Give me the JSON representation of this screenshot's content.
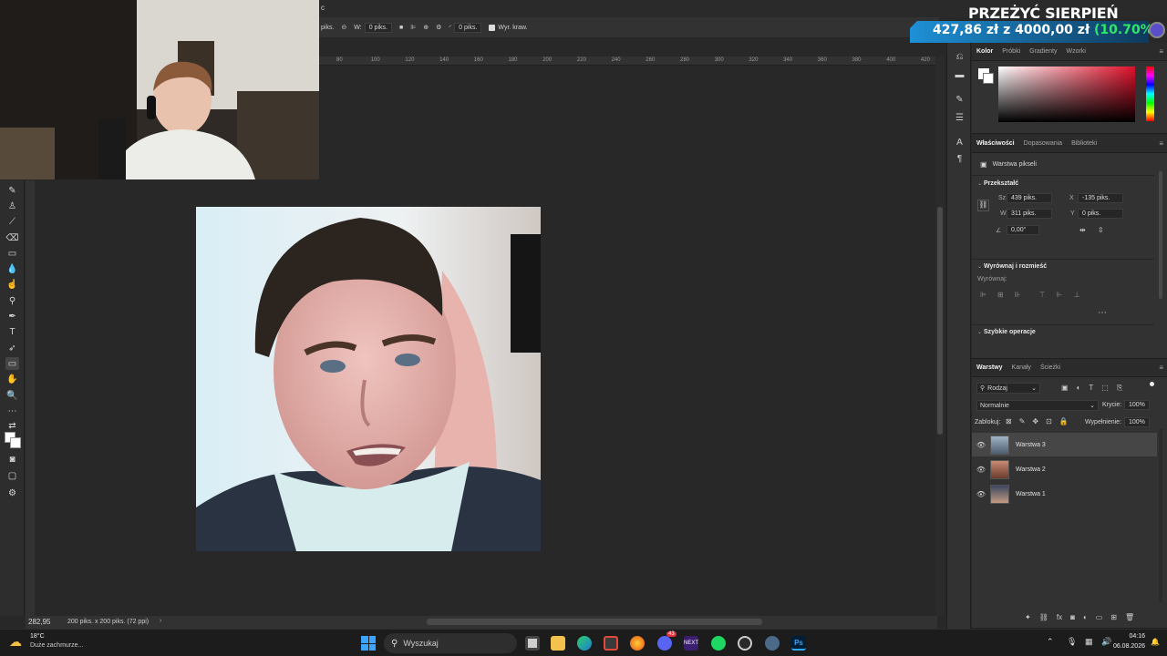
{
  "document": {
    "options": {
      "size_unit": "piks.",
      "w_label": "W:",
      "w_value": "0 piks.",
      "corner_value": "0 piks.",
      "align_edges": "Wyr. kraw."
    },
    "ruler_ticks": [
      "80",
      "100",
      "120",
      "140",
      "160",
      "180",
      "200",
      "220",
      "240",
      "260",
      "280",
      "300",
      "320",
      "340",
      "360",
      "380",
      "400",
      "420"
    ],
    "zoom": "282,95",
    "doc_info": "200 piks. x 200 piks. (72 ppi)"
  },
  "color_panel": {
    "tabs": [
      "Kolor",
      "Próbki",
      "Gradienty",
      "Wzorki"
    ]
  },
  "properties_panel": {
    "tabs": [
      "Właściwości",
      "Dopasowania",
      "Biblioteki"
    ],
    "layer_type": "Warstwa pikseli",
    "transform": {
      "title": "Przekształć",
      "w_label": "Sz",
      "w_value": "439 piks.",
      "h_label": "W",
      "h_value": "311 piks.",
      "x_label": "X",
      "x_value": "-135 piks.",
      "y_label": "Y",
      "y_value": "0 piks.",
      "angle": "0,00°"
    },
    "align": {
      "title": "Wyrównaj i rozmieść",
      "sub": "Wyrównaj:"
    },
    "quick_actions": "Szybkie operacje"
  },
  "layers_panel": {
    "tabs": [
      "Warstwy",
      "Kanały",
      "Ścieżki"
    ],
    "filter_kind": "Rodzaj",
    "blend_mode": "Normalnie",
    "opacity_label": "Krycie:",
    "opacity_value": "100%",
    "lock_label": "Zablokuj:",
    "fill_label": "Wypełnienie:",
    "fill_value": "100%",
    "layers": [
      {
        "name": "Warstwa 3",
        "selected": true
      },
      {
        "name": "Warstwa 2",
        "selected": false
      },
      {
        "name": "Warstwa 1",
        "selected": false
      }
    ]
  },
  "banner": {
    "title": "PRZEŻYĆ SIERPIEŃ",
    "current": "427,86 zł",
    "connector": "z",
    "goal": "4000,00 zł",
    "percent": "(10.70%)",
    "progress": 0.107
  },
  "taskbar": {
    "weather_temp": "18°C",
    "weather_desc": "Duże zachmurze...",
    "search_placeholder": "Wyszukaj",
    "time": "04:16",
    "date": "06.08.2026",
    "badge": "43"
  },
  "colors": {
    "accent": "#1e90d6",
    "banner_green": "#2ee66a",
    "ps_blue": "#31a8ff"
  }
}
